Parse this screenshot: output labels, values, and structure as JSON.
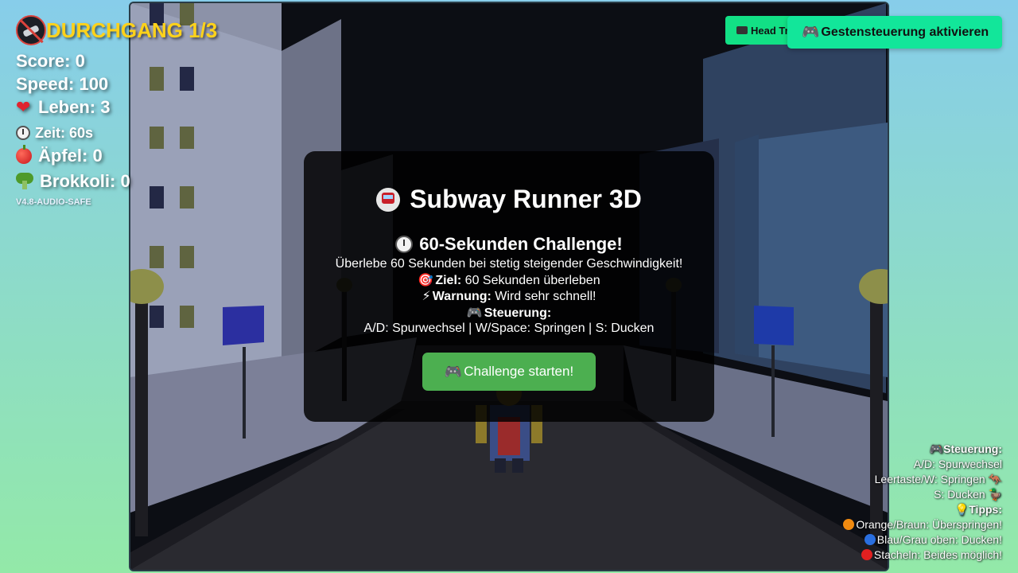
{
  "hud": {
    "level_label": "DURCHGANG 1/3",
    "score": "Score: 0",
    "speed": "Speed: 100",
    "lives": "Leben: 3",
    "time": "Zeit: 60s",
    "apples": "Äpfel: 0",
    "broccoli": "Brokkoli: 0",
    "version": "V4.8-AUDIO-SAFE"
  },
  "buttons": {
    "head_tracking": "Head Tracking",
    "gesture_control": "Gestensteuerung aktivieren"
  },
  "modal": {
    "title": "Subway Runner 3D",
    "subtitle": "60-Sekunden Challenge!",
    "description": "Überlebe 60 Sekunden bei stetig steigender Geschwindigkeit!",
    "goal_label": "Ziel:",
    "goal_text": " 60 Sekunden überleben",
    "warning_label": "Warnung:",
    "warning_text": " Wird sehr schnell!",
    "controls_label": "Steuerung:",
    "controls_text": "A/D: Spurwechsel | W/Space: Springen | S: Ducken",
    "start_button": "Challenge starten!"
  },
  "hints": {
    "controls_header": "Steuerung:",
    "lane_change": "A/D: Spurwechsel",
    "jump": "Leertaste/W: Springen",
    "duck": "S: Ducken",
    "tips_header": "Tipps:",
    "tip_orange": "Orange/Braun: Überspringen!",
    "tip_blue": "Blau/Grau oben: Ducken!",
    "tip_red": "Stacheln: Beides möglich!"
  },
  "colors": {
    "level_label": "#ffd21a",
    "start_button": "#4caf50",
    "gesture_button": "#12e69a",
    "head_button": "#12e085"
  }
}
